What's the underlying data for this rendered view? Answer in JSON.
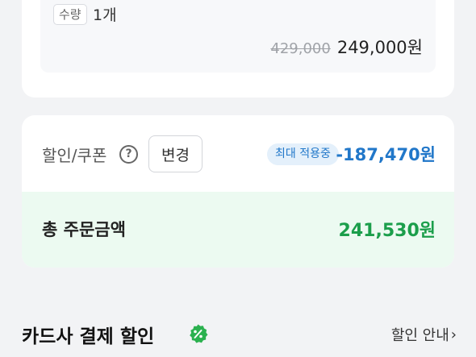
{
  "product": {
    "qty_tag": "수량",
    "qty_value": "1개",
    "original_price": "429,000",
    "sale_price": "249,000원"
  },
  "coupon": {
    "label": "할인/쿠폰",
    "help_icon": "?",
    "change_button": "변경",
    "max_badge": "최대 적용중",
    "discount_amount": "-187,470원"
  },
  "total": {
    "label": "총 주문금액",
    "amount": "241,530원"
  },
  "card_discount": {
    "title": "카드사 결제 할인",
    "info_link": "할인 안내",
    "chevron": "›"
  },
  "colors": {
    "discount_blue": "#2177c9",
    "total_green": "#1b9e4b",
    "total_bg": "#ecfaf1"
  }
}
